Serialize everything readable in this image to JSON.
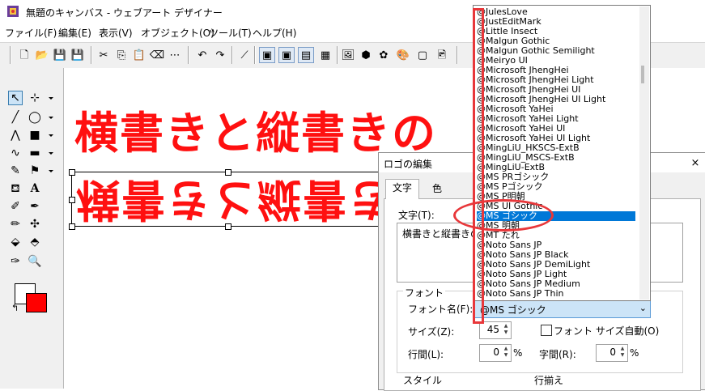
{
  "window": {
    "title": "無題のキャンバス - ウェブアート デザイナー"
  },
  "menu": [
    "ファイル(F)",
    "編集(E)",
    "表示(V)",
    "オブジェクト(O)",
    "ツール(T)",
    "ヘルプ(H)"
  ],
  "canvas": {
    "logo_horizontal": "横書きと縦書きの",
    "logo_flipped": "横書きと縦書きの"
  },
  "colors": {
    "foreground": "#ffffff",
    "background": "#ff0000",
    "logo": "#ff1010",
    "annotation": "#e8373a",
    "selection": "#0078d7"
  },
  "dialog": {
    "title": "ロゴの編集",
    "close": "×",
    "tabs": [
      "文字",
      "色"
    ],
    "text_label": "文字(T):",
    "text_value": "横書きと縦書きの",
    "font_group_label": "フォント",
    "font_name_label": "フォント名(F):",
    "font_name_value": "@MS ゴシック",
    "size_label": "サイズ(Z):",
    "size_value": "45",
    "auto_size_label": "フォント サイズ自動(O)",
    "line_spacing_label": "行間(L):",
    "line_spacing_value": "0",
    "char_spacing_label": "字間(R):",
    "char_spacing_value": "0",
    "percent": "%",
    "style_label": "スタイル",
    "align_label": "行揃え"
  },
  "font_list": {
    "items": [
      "@JulesLove",
      "@JustEditMark",
      "@Little Insect",
      "@Malgun Gothic",
      "@Malgun Gothic Semilight",
      "@Meiryo UI",
      "@Microsoft JhengHei",
      "@Microsoft JhengHei Light",
      "@Microsoft JhengHei UI",
      "@Microsoft JhengHei UI Light",
      "@Microsoft YaHei",
      "@Microsoft YaHei Light",
      "@Microsoft YaHei UI",
      "@Microsoft YaHei UI Light",
      "@MingLiU_HKSCS-ExtB",
      "@MingLiU_MSCS-ExtB",
      "@MingLiU-ExtB",
      "@MS PRゴシック",
      "@MS Pゴシック",
      "@MS P明朝",
      "@MS UI Gothic",
      "@MS ゴシック",
      "@MS 明朝",
      "@MT たれ",
      "@Noto Sans JP",
      "@Noto Sans JP Black",
      "@Noto Sans JP DemiLight",
      "@Noto Sans JP Light",
      "@Noto Sans JP Medium",
      "@Noto Sans JP Thin"
    ],
    "selected": "@MS ゴシック"
  }
}
